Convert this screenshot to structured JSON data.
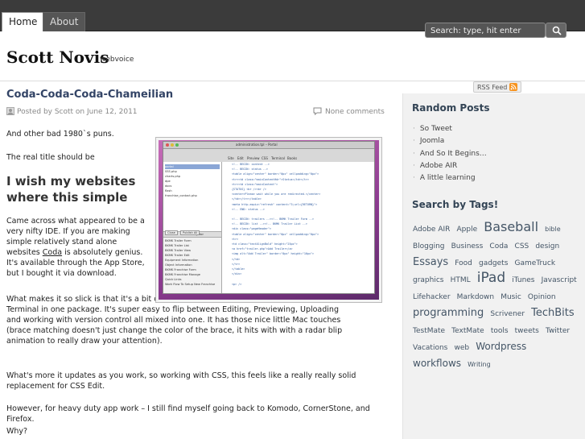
{
  "nav": {
    "home": "Home",
    "about": "About"
  },
  "search": {
    "placeholder": "Search: type, hit enter"
  },
  "site": {
    "title": "Scott Novis",
    "description": "webvoice"
  },
  "post": {
    "title": "Coda-Coda-Coda-Chameilian",
    "meta": "Posted by Scott on June 12, 2011",
    "comments": "None comments",
    "p1": "And other bad 1980`s puns.",
    "p2": "The real title should be",
    "heading": "I wish my websites where this simple",
    "p3_pre": "Came across what appeared to be a very nifty IDE. If you are making simple relatively stand alone websites ",
    "p3_link": "Coda",
    "p3_post": " is absolutely genius. It's available through the App Store, but I bought it via download.",
    "p4": "What makes it so slick is that it's a bit of Komodo, Safari, CSS Edit, FileZilla, SVN and Terminal in one package. It's super easy to flip between Editing, Previewing, Uploading and working with version control all mixed into one. It has those nice little Mac touches (brace matching doesn't just change the color of the brace, it hits with with a radar blip animation to really draw your attention).",
    "p5": "What's more it updates as you work, so working with CSS, this feels like a really really solid replacement for CSS Edit.",
    "p6": "However, for heavy duty app work – I still find myself going back to Komodo, CornerStone, and Firefox.",
    "p7": "Why?"
  },
  "screenshot": {
    "window_title": "administration.tpl – Portal",
    "tabs": [
      "Site",
      "Edit",
      "Preview",
      "CSS",
      "Terminal",
      "Books"
    ],
    "files": [
      "portal",
      "SSS.php",
      "charts.php",
      "dpe",
      "docs",
      "flash",
      "franchise_contact.php"
    ],
    "navigator_title": "Coda Navigator",
    "navigator": [
      "BKMK Trailer Form",
      "BKMK Trailer List",
      "BKMK Trailer View",
      "BKMK Trailer Edit",
      "Equipment Information",
      "Object Information",
      "BKMK Franchise Form",
      "BKMK Franchise Manage",
      "Quick Links",
      "Work Flow To Setup New Franchise"
    ],
    "code": [
      "<!-- BEGIN: content -->",
      "<!-- BEGIN: status -->",
      "<table align=\"center\" border=\"0px\" cellpadding=\"0px\">",
      "<tr><td class=\"mainContentHdr\">Status</td></tr>",
      "<tr><td class=\"mainContent\">",
      "{STATUS} <br /><br />",
      "<center>Please wait while you are redirected.</center>",
      "</td></tr></table>",
      "<meta http-equiv=\"refresh\" content=\"3;url={RETURN}\">",
      "<!-- END: status -->",
      "",
      "<!-- BEGIN: trailers --><!-- BKMK Trailer Form -->",
      "<!-- BEGIN: list --><!-- BKMK Trailer List -->",
      "<div class=\"pageHeader\">",
      "<table align=\"center\" border=\"0px\" cellpadding=\"0px\">",
      "<tr>",
      "<td class=\"textAlignBold\" height=\"25px\">",
      "<a href=\"trailer.php\">Add Trailer</a>",
      "<img alt=\"Add Trailer\" border=\"0px\" height=\"16px\">",
      "</td>",
      "</tr>",
      "</table>",
      "</div>",
      "",
      "<p> />"
    ],
    "buttons": [
      "Close",
      "Publish All"
    ]
  },
  "sidebar": {
    "rss": "RSS Feed",
    "random_title": "Random Posts",
    "random_posts": [
      "So Tweet",
      "Joomla",
      "And So It Begins…",
      "Adobe AIR",
      "A little learning"
    ],
    "tags_title": "Search by Tags!",
    "tags": [
      {
        "label": "Adobe AIR",
        "size": 9
      },
      {
        "label": "Apple",
        "size": 9
      },
      {
        "label": "Baseball",
        "size": 16
      },
      {
        "label": "bible",
        "size": 8
      },
      {
        "label": "Blogging",
        "size": 9
      },
      {
        "label": "Business",
        "size": 9
      },
      {
        "label": "Coda",
        "size": 9
      },
      {
        "label": "CSS",
        "size": 9
      },
      {
        "label": "design",
        "size": 9
      },
      {
        "label": "Essays",
        "size": 13
      },
      {
        "label": "Food",
        "size": 9
      },
      {
        "label": "gadgets",
        "size": 9
      },
      {
        "label": "GameTruck",
        "size": 9
      },
      {
        "label": "graphics",
        "size": 9
      },
      {
        "label": "HTML",
        "size": 9
      },
      {
        "label": "iPad",
        "size": 17
      },
      {
        "label": "iTunes",
        "size": 9
      },
      {
        "label": "Javascript",
        "size": 9
      },
      {
        "label": "Lifehacker",
        "size": 9
      },
      {
        "label": "Markdown",
        "size": 9
      },
      {
        "label": "Music",
        "size": 9
      },
      {
        "label": "Opinion",
        "size": 9
      },
      {
        "label": "programming",
        "size": 13
      },
      {
        "label": "Scrivener",
        "size": 9
      },
      {
        "label": "TechBits",
        "size": 13
      },
      {
        "label": "TestMate",
        "size": 9
      },
      {
        "label": "TextMate",
        "size": 9
      },
      {
        "label": "tools",
        "size": 9
      },
      {
        "label": "tweets",
        "size": 9
      },
      {
        "label": "Twitter",
        "size": 9
      },
      {
        "label": "Vacations",
        "size": 9
      },
      {
        "label": "web",
        "size": 9
      },
      {
        "label": "Wordpress",
        "size": 12
      },
      {
        "label": "workflows",
        "size": 12
      },
      {
        "label": "Writing",
        "size": 8
      }
    ]
  }
}
